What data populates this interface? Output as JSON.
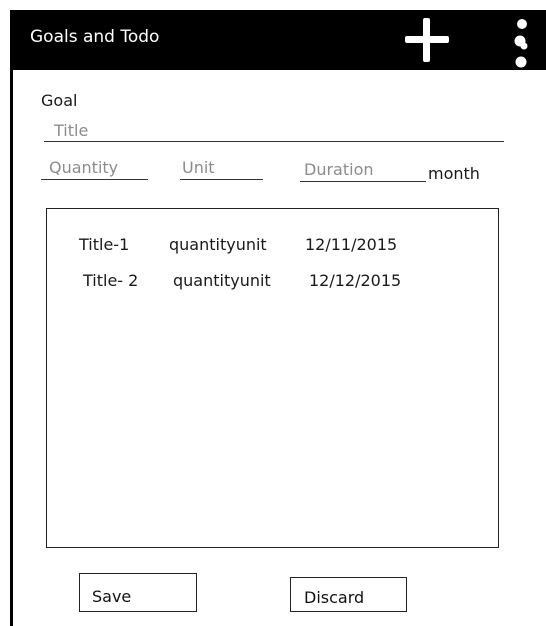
{
  "app_bar": {
    "title": "Goals and Todo",
    "add_icon": "plus-icon",
    "menu_icon": "more-vertical-icon",
    "background": "#000000",
    "foreground": "#ffffff"
  },
  "goal_form": {
    "label": "Goal",
    "title_placeholder": "Title",
    "quantity_placeholder": "Quantity",
    "unit_placeholder": "Unit",
    "duration_placeholder": "Duration",
    "duration_suffix": "month"
  },
  "goals_list": {
    "items": [
      {
        "title": "Title-1",
        "quantity_unit": "quantityunit",
        "date": "12/11/2015"
      },
      {
        "title": "Title- 2",
        "quantity_unit": "quantityunit",
        "date": "12/12/2015"
      }
    ]
  },
  "actions": {
    "save_label": "Save",
    "discard_label": "Discard"
  }
}
